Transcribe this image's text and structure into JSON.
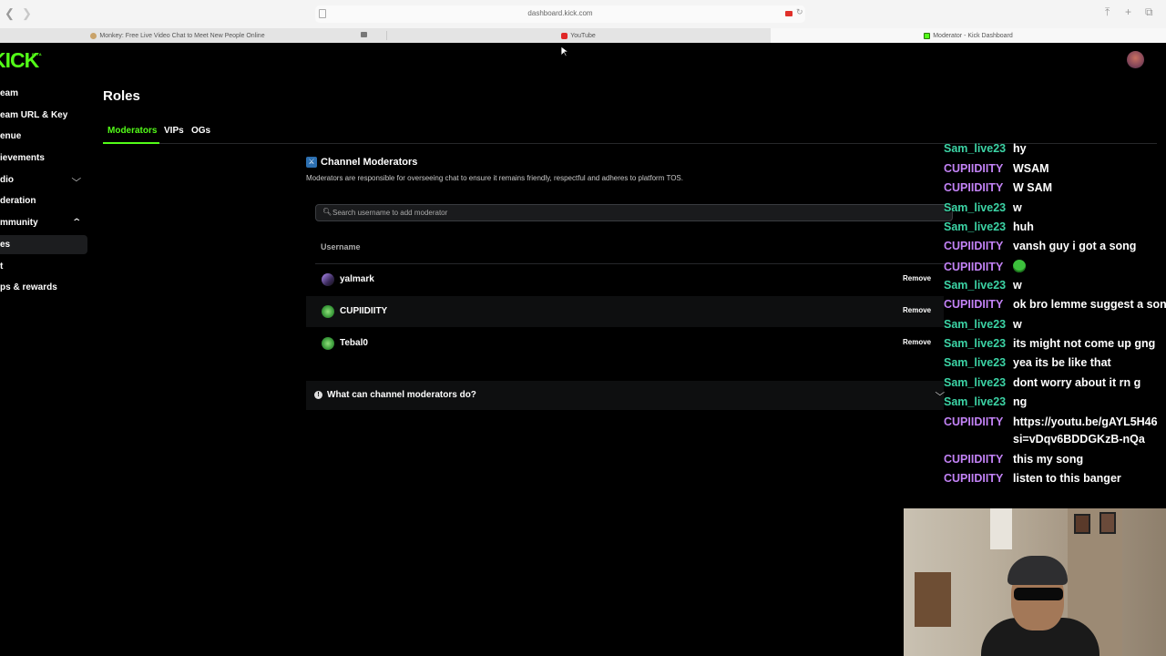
{
  "browser": {
    "url": "dashboard.kick.com",
    "tabs": [
      {
        "title": "Monkey: Free Live Video Chat to Meet New People Online",
        "icon": "monkey-favicon"
      },
      {
        "title": "YouTube",
        "icon": "youtube-favicon"
      },
      {
        "title": "Moderator - Kick Dashboard",
        "icon": "kick-favicon"
      }
    ]
  },
  "dashboard": {
    "logo": "KICK",
    "logo_badge": "BETA",
    "sidebar": {
      "items": [
        {
          "label": "eam"
        },
        {
          "label": "eam URL & Key"
        },
        {
          "label": "enue"
        },
        {
          "label": "ievements"
        },
        {
          "label": "dio"
        },
        {
          "label": "deration"
        },
        {
          "label": "mmunity"
        },
        {
          "label": "es"
        },
        {
          "label": "t"
        },
        {
          "label": "ps & rewards"
        }
      ]
    },
    "page_title": "Roles",
    "tabs": [
      {
        "label": "Moderators",
        "active": true
      },
      {
        "label": "VIPs",
        "active": false
      },
      {
        "label": "OGs",
        "active": false
      }
    ],
    "section": {
      "title": "Channel Moderators",
      "description": "Moderators are responsible for overseeing chat to ensure it remains friendly, respectful and adheres to platform TOS.",
      "search_placeholder": "Search username to add moderator",
      "column_header": "Username",
      "remove_label": "Remove",
      "moderators": [
        {
          "username": "yalmark"
        },
        {
          "username": "CUPIIDIITY"
        },
        {
          "username": "Tebal0"
        }
      ],
      "faq": "What can channel moderators do?"
    }
  },
  "chat": {
    "messages": [
      {
        "user": "Sam_live23",
        "text": "hy"
      },
      {
        "user": "CUPIIDIITY",
        "text": "WSAM"
      },
      {
        "user": "CUPIIDIITY",
        "text": "W SAM"
      },
      {
        "user": "Sam_live23",
        "text": "w"
      },
      {
        "user": "Sam_live23",
        "text": "huh"
      },
      {
        "user": "CUPIIDIITY",
        "text": "vansh guy i got a song"
      },
      {
        "user": "CUPIIDIITY",
        "text": ""
      },
      {
        "user": "Sam_live23",
        "text": "w"
      },
      {
        "user": "CUPIIDIITY",
        "text": "ok bro lemme suggest a son"
      },
      {
        "user": "Sam_live23",
        "text": "w"
      },
      {
        "user": "Sam_live23",
        "text": "its might not come up gng"
      },
      {
        "user": "Sam_live23",
        "text": "yea its be like that"
      },
      {
        "user": "Sam_live23",
        "text": "dont worry about it rn g"
      },
      {
        "user": "Sam_live23",
        "text": "ng"
      },
      {
        "user": "CUPIIDIITY",
        "text": "https://youtu.be/gAYL5H46"
      },
      {
        "user": "",
        "text": "si=vDqv6BDDGKzB-nQa"
      },
      {
        "user": "CUPIIDIITY",
        "text": "this my song"
      },
      {
        "user": "CUPIIDIITY",
        "text": "listen to this banger"
      }
    ]
  },
  "colors": {
    "kick_green": "#53fc18",
    "chat_green_user": "#3cd3a5",
    "chat_purple_user": "#c282f5"
  }
}
